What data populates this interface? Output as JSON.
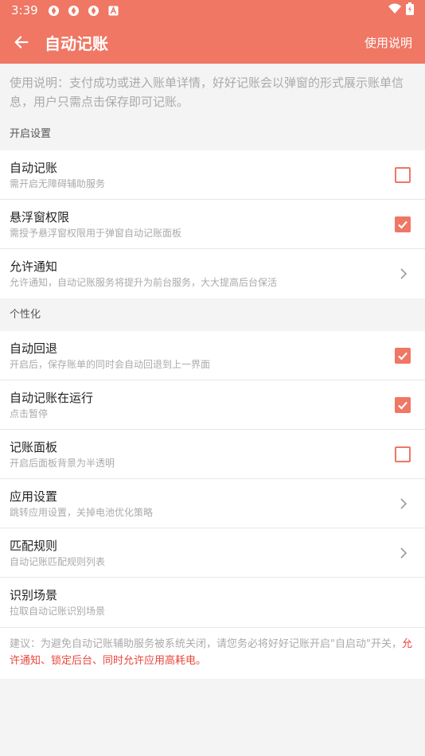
{
  "status": {
    "time": "3:39",
    "icons": [
      "app-notification-icon",
      "app-notification-icon",
      "app-notification-icon",
      "a-letter-icon"
    ],
    "right_icons": [
      "wifi-icon",
      "battery-icon"
    ]
  },
  "appbar": {
    "title": "自动记账",
    "help_label": "使用说明"
  },
  "intro": "使用说明：支付成功或进入账单详情，好好记账会以弹窗的形式展示账单信息，用户只需点击保存即可记账。",
  "sections": {
    "open": "开启设置",
    "personal": "个性化"
  },
  "open_items": [
    {
      "title": "自动记账",
      "subtitle": "需开启无障碍辅助服务",
      "control": "checkbox",
      "checked": false
    },
    {
      "title": "悬浮窗权限",
      "subtitle": "需授予悬浮窗权限用于弹窗自动记账面板",
      "control": "checkbox",
      "checked": true
    },
    {
      "title": "允许通知",
      "subtitle": "允许通知，自动记账服务将提升为前台服务，大大提高后台保活",
      "control": "chevron"
    }
  ],
  "personal_items": [
    {
      "title": "自动回退",
      "subtitle": "开启后，保存账单的同时会自动回退到上一界面",
      "control": "checkbox",
      "checked": true
    },
    {
      "title": "自动记账在运行",
      "subtitle": "点击暂停",
      "control": "checkbox",
      "checked": true
    },
    {
      "title": "记账面板",
      "subtitle": "开启后面板背景为半透明",
      "control": "checkbox",
      "checked": false
    },
    {
      "title": "应用设置",
      "subtitle": "跳转应用设置，关掉电池优化策略",
      "control": "chevron"
    },
    {
      "title": "匹配规则",
      "subtitle": "自动记账匹配规则列表",
      "control": "chevron"
    },
    {
      "title": "识别场景",
      "subtitle": "拉取自动记账识别场景",
      "control": "none"
    }
  ],
  "notice": {
    "gray": "建议：为避免自动记账辅助服务被系统关闭，请您务必将好好记账开启\"自启动\"开关，",
    "red": "允许通知、锁定后台、同时允许应用高耗电。"
  },
  "colors": {
    "accent": "#ef7764",
    "warning": "#e8453c"
  }
}
